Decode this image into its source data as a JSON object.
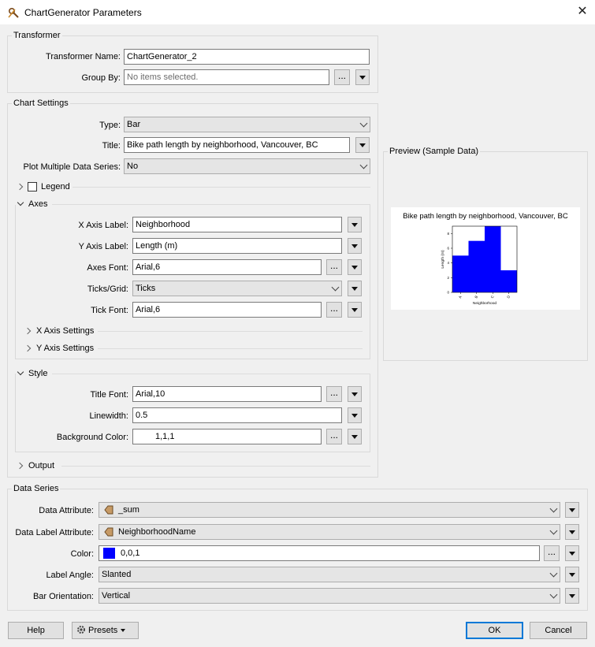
{
  "window": {
    "title": "ChartGenerator Parameters"
  },
  "transformer": {
    "heading": "Transformer",
    "name_label": "Transformer Name:",
    "name_value": "ChartGenerator_2",
    "group_by_label": "Group By:",
    "group_by_placeholder": "No items selected.",
    "ellipsis": "..."
  },
  "chart_settings": {
    "heading": "Chart Settings",
    "type_label": "Type:",
    "type_value": "Bar",
    "title_label": "Title:",
    "title_value": "Bike path length by neighborhood, Vancouver, BC",
    "multi_label": "Plot Multiple Data Series:",
    "multi_value": "No",
    "legend_label": "Legend",
    "axes": {
      "heading": "Axes",
      "x_label_label": "X Axis Label:",
      "x_label_value": "Neighborhood",
      "y_label_label": "Y Axis Label:",
      "y_label_value": "Length (m)",
      "axes_font_label": "Axes Font:",
      "axes_font_value": "Arial,6",
      "ticks_label": "Ticks/Grid:",
      "ticks_value": "Ticks",
      "tick_font_label": "Tick Font:",
      "tick_font_value": "Arial,6",
      "x_settings": "X Axis Settings",
      "y_settings": "Y Axis Settings"
    },
    "style": {
      "heading": "Style",
      "title_font_label": "Title Font:",
      "title_font_value": "Arial,10",
      "linewidth_label": "Linewidth:",
      "linewidth_value": "0.5",
      "bg_label": "Background Color:",
      "bg_value": "1,1,1"
    },
    "output_label": "Output"
  },
  "preview": {
    "heading": "Preview (Sample Data)"
  },
  "chart_data": {
    "type": "bar",
    "title": "Bike path length by neighborhood, Vancouver, BC",
    "xlabel": "Neighborhood",
    "ylabel": "Length (m)",
    "categories": [
      "A",
      "B",
      "C",
      "D"
    ],
    "values": [
      5,
      7,
      9,
      3
    ],
    "ylim": [
      0,
      9
    ],
    "yticks": [
      "0",
      "2",
      "4",
      "6",
      "8"
    ],
    "color": "#0000ff",
    "grid": false
  },
  "data_series": {
    "heading": "Data Series",
    "data_attr_label": "Data Attribute:",
    "data_attr_value": "_sum",
    "data_label_attr_label": "Data Label Attribute:",
    "data_label_attr_value": "NeighborhoodName",
    "color_label": "Color:",
    "color_value": "0,0,1",
    "color_swatch": "#0000ff",
    "label_angle_label": "Label Angle:",
    "label_angle_value": "Slanted",
    "orientation_label": "Bar Orientation:",
    "orientation_value": "Vertical"
  },
  "footer": {
    "help": "Help",
    "presets": "Presets",
    "ok": "OK",
    "cancel": "Cancel"
  }
}
